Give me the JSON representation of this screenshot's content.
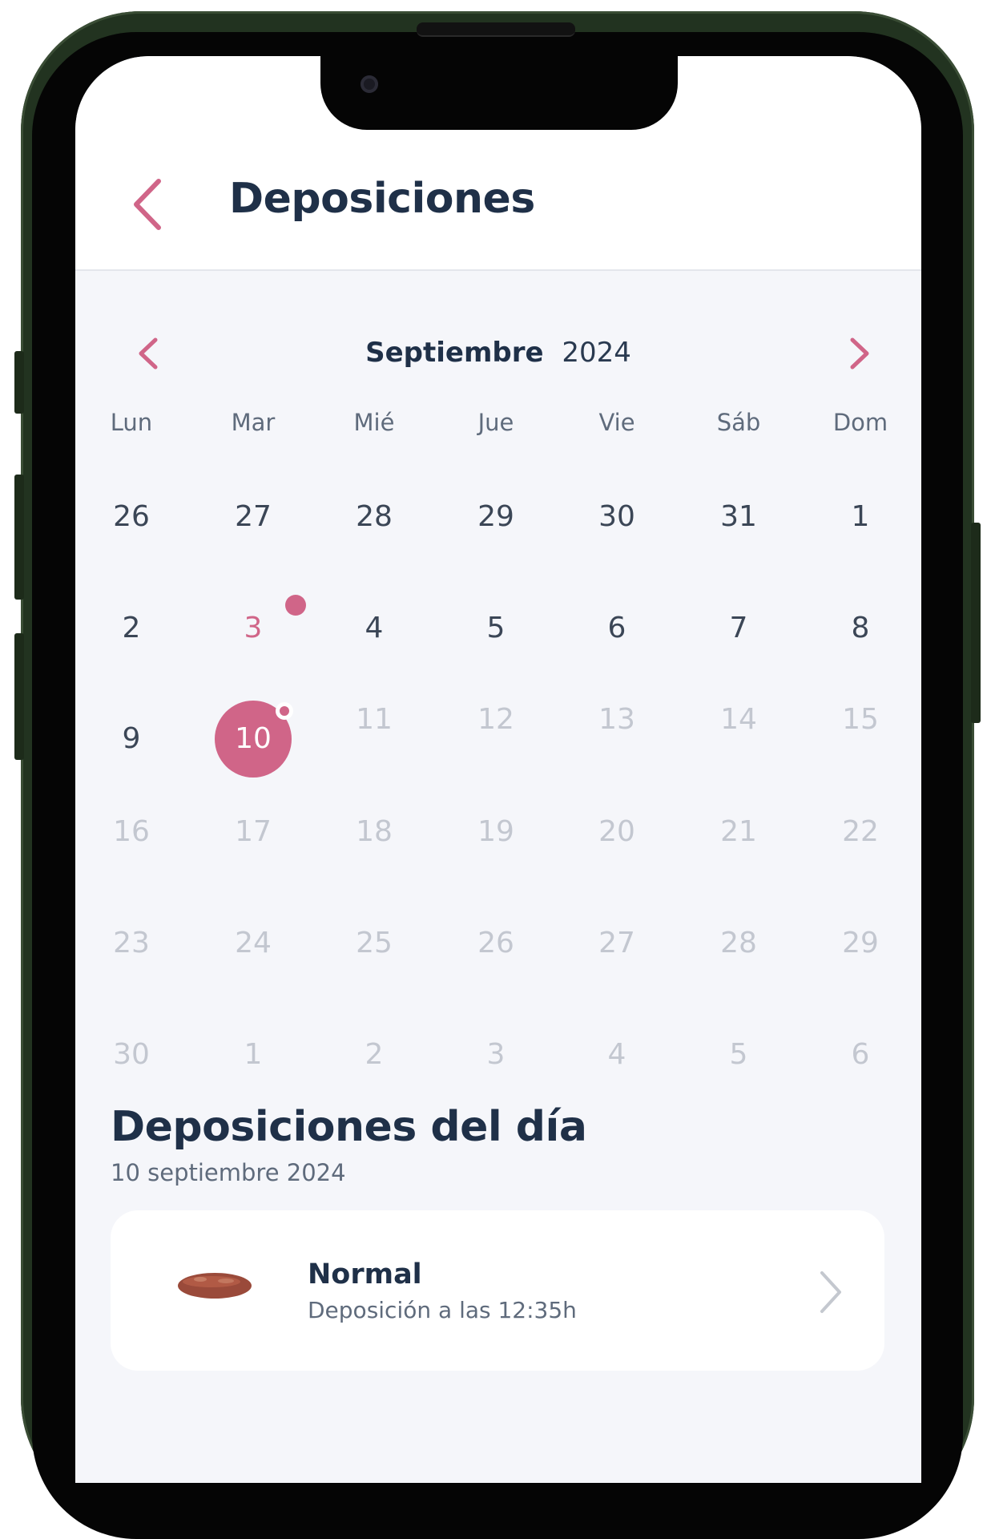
{
  "header": {
    "title": "Deposiciones",
    "back_icon": "chevron-left-icon"
  },
  "calendar": {
    "month": "Septiembre",
    "year": "2024",
    "prev_icon": "chevron-left-icon",
    "next_icon": "chevron-right-icon",
    "weekdays": [
      "Lun",
      "Mar",
      "Mié",
      "Jue",
      "Vie",
      "Sáb",
      "Dom"
    ],
    "weeks": [
      [
        "26",
        "27",
        "28",
        "29",
        "30",
        "31",
        "1"
      ],
      [
        "2",
        "3",
        "4",
        "5",
        "6",
        "7",
        "8"
      ],
      [
        "9",
        "10",
        "11",
        "12",
        "13",
        "14",
        "15"
      ],
      [
        "16",
        "17",
        "18",
        "19",
        "20",
        "21",
        "22"
      ],
      [
        "23",
        "24",
        "25",
        "26",
        "27",
        "28",
        "29"
      ],
      [
        "30",
        "1",
        "2",
        "3",
        "4",
        "5",
        "6"
      ]
    ],
    "selected_day": "10",
    "marked_days": [
      "3"
    ],
    "accent_color": "#d06588"
  },
  "day_section": {
    "title": "Deposiciones del día",
    "date": "10 septiembre 2024"
  },
  "entries": [
    {
      "type": "Normal",
      "detail": "Deposición a las 12:35h",
      "icon": "stool-icon"
    }
  ]
}
